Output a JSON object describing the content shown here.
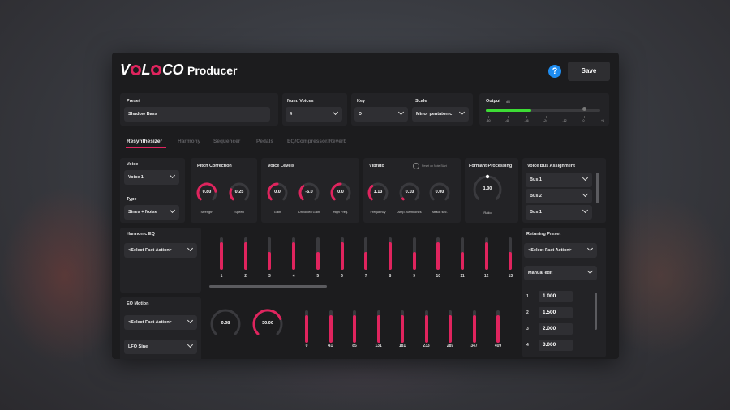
{
  "app": {
    "brand": "VOLOCO",
    "brand_pre": "V",
    "brand_post": "L",
    "brand_end": "CO",
    "product": "Producer",
    "help_label": "?",
    "save_label": "Save"
  },
  "top": {
    "preset": {
      "label": "Preset",
      "value": "Shadow Bass"
    },
    "num_voices": {
      "label": "Num. Voices",
      "value": "4"
    },
    "key": {
      "label": "Key",
      "value": "D"
    },
    "scale": {
      "label": "Scale",
      "value": "Minor pentatonic"
    },
    "output": {
      "label": "Output",
      "unit": "dB",
      "level": 0.4,
      "ticks": [
        "-60",
        "-48",
        "-36",
        "-24",
        "-12",
        "0",
        "+6"
      ]
    }
  },
  "tabs": [
    "Resynthesizer",
    "Harmony",
    "Sequencer",
    "Pedals",
    "EQ/Compressor/Reverb"
  ],
  "voice": {
    "label": "Voice",
    "value": "Voice 1",
    "type_label": "Type",
    "type_value": "Sines + Noise"
  },
  "pitch_correction": {
    "label": "Pitch Correction",
    "strength": {
      "value": "0.80",
      "caption": "Strength"
    },
    "speed": {
      "value": "0.25",
      "caption": "Speed"
    }
  },
  "voice_levels": {
    "label": "Voice Levels",
    "gain": {
      "value": "0.0",
      "caption": "Gain"
    },
    "unvoiced": {
      "value": "-6.0",
      "caption": "Unvoiced Gain"
    },
    "high_freq": {
      "value": "0.0",
      "caption": "High Freq."
    }
  },
  "vibrato": {
    "label": "Vibrato",
    "reset_label": "Reset on Note Start",
    "frequency": {
      "value": "1.13",
      "caption": "Frequency"
    },
    "amp": {
      "value": "0.10",
      "caption": "Amp. Semitones"
    },
    "attack": {
      "value": "0.00",
      "caption": "Attack sec."
    }
  },
  "formant": {
    "label": "Formant Processing",
    "ratio": {
      "value": "1.00",
      "caption": "Ratio"
    }
  },
  "voice_bus": {
    "label": "Voice Bus Assignment",
    "buses": [
      "Bus 1",
      "Bus 2",
      "Bus 1"
    ]
  },
  "harmonic_eq": {
    "label": "Harmonic EQ",
    "action": "<Select Fast Action>",
    "bars": [
      {
        "n": "1",
        "v": 0.85
      },
      {
        "n": "2",
        "v": 0.85
      },
      {
        "n": "3",
        "v": 0.55
      },
      {
        "n": "4",
        "v": 0.85
      },
      {
        "n": "5",
        "v": 0.55
      },
      {
        "n": "6",
        "v": 0.85
      },
      {
        "n": "7",
        "v": 0.55
      },
      {
        "n": "8",
        "v": 0.85
      },
      {
        "n": "9",
        "v": 0.55
      },
      {
        "n": "10",
        "v": 0.85
      },
      {
        "n": "11",
        "v": 0.55
      },
      {
        "n": "12",
        "v": 0.85
      },
      {
        "n": "13",
        "v": 0.55
      }
    ]
  },
  "retuning": {
    "label": "Retuning Preset",
    "action": "<Select Fast Action>",
    "mode": "Manual edit",
    "ratios": [
      {
        "i": "1",
        "v": "1.000"
      },
      {
        "i": "2",
        "v": "1.500"
      },
      {
        "i": "3",
        "v": "2.000"
      },
      {
        "i": "4",
        "v": "3.000"
      }
    ]
  },
  "eq_motion": {
    "label": "EQ Motion",
    "action": "<Select Fast Action>",
    "lfo": "LFO Sine",
    "knob1": {
      "value": "0.08"
    },
    "knob2": {
      "value": "30.00"
    },
    "bars": [
      {
        "n": "0",
        "v": 0.85
      },
      {
        "n": "41",
        "v": 0.85
      },
      {
        "n": "85",
        "v": 0.85
      },
      {
        "n": "131",
        "v": 0.85
      },
      {
        "n": "181",
        "v": 0.85
      },
      {
        "n": "233",
        "v": 0.85
      },
      {
        "n": "289",
        "v": 0.85
      },
      {
        "n": "347",
        "v": 0.85
      },
      {
        "n": "409",
        "v": 0.85
      }
    ]
  },
  "colors": {
    "accent": "#e0245e",
    "output_green": "#3ddc35",
    "help_blue": "#1e8cf0"
  }
}
